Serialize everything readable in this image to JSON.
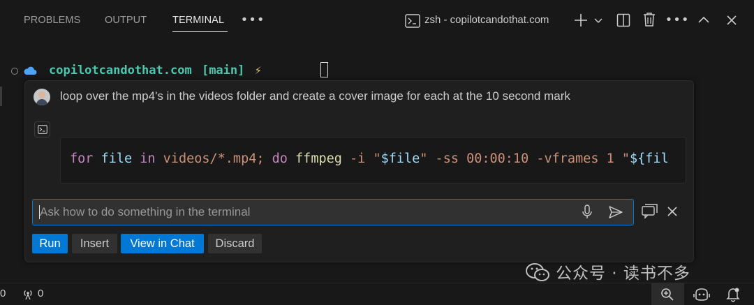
{
  "panel": {
    "tabs": [
      {
        "label": "PROBLEMS"
      },
      {
        "label": "OUTPUT"
      },
      {
        "label": "TERMINAL"
      }
    ],
    "terminal_name": "zsh - copilotcandothat.com"
  },
  "terminal": {
    "prompt_host": "copilotcandothat.com",
    "prompt_branch": "[main]",
    "prompt_symbol": "⚡"
  },
  "chat": {
    "user_message": "loop over the mp4's in the videos folder and create a cover image for each at the 10 second mark",
    "code_tokens": [
      {
        "text": "for",
        "color": "#c586c0"
      },
      {
        "text": " ",
        "color": "#cccccc"
      },
      {
        "text": "file",
        "color": "#9cdcfe"
      },
      {
        "text": " ",
        "color": "#cccccc"
      },
      {
        "text": "in",
        "color": "#c586c0"
      },
      {
        "text": " videos/*.mp4; ",
        "color": "#ce9178"
      },
      {
        "text": "do",
        "color": "#c586c0"
      },
      {
        "text": " ",
        "color": "#cccccc"
      },
      {
        "text": "ffmpeg",
        "color": "#dcdcaa"
      },
      {
        "text": " -i ",
        "color": "#ce9178"
      },
      {
        "text": "\"",
        "color": "#ce9178"
      },
      {
        "text": "$file",
        "color": "#9cdcfe"
      },
      {
        "text": "\" -ss 00:00:10 -vframes 1 \"",
        "color": "#ce9178"
      },
      {
        "text": "${fil",
        "color": "#9cdcfe"
      }
    ],
    "input_placeholder": "Ask how to do something in the terminal",
    "buttons": {
      "run": "Run",
      "insert": "Insert",
      "view_in_chat": "View in Chat",
      "discard": "Discard"
    }
  },
  "statusbar": {
    "left_count": "0",
    "ports_count": "0"
  },
  "watermark": "公众号 · 读书不多",
  "colors": {
    "accent": "#0078d4",
    "prompt_host": "#4ec9b0",
    "prompt_branch": "#4ec9b0",
    "prompt_symbol": "#e5c07b"
  }
}
